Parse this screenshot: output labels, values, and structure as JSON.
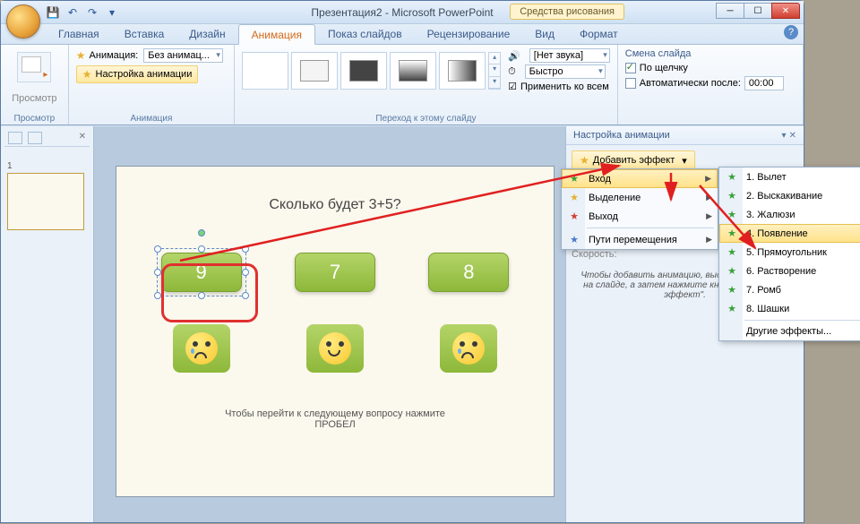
{
  "title": {
    "doc": "Презентация2",
    "app": "Microsoft PowerPoint"
  },
  "contextual_tab": "Средства рисования",
  "win_buttons": {
    "min": "─",
    "max": "☐",
    "close": "✕"
  },
  "tabs": [
    "Главная",
    "Вставка",
    "Дизайн",
    "Анимация",
    "Показ слайдов",
    "Рецензирование",
    "Вид",
    "Формат"
  ],
  "active_tab_index": 3,
  "ribbon": {
    "preview": {
      "label": "Просмотр",
      "btn": "Просмотр"
    },
    "animation": {
      "label": "Анимация",
      "animate_label": "Анимация:",
      "animate_value": "Без анимац...",
      "custom_btn": "Настройка анимации"
    },
    "transition": {
      "label": "Переход к этому слайду",
      "sound_icon": "🔊",
      "sound_value": "[Нет звука]",
      "speed_icon": "⏱",
      "speed_value": "Быстро",
      "apply_all_icon": "☑",
      "apply_all": "Применить ко всем"
    },
    "advance": {
      "title": "Смена слайда",
      "on_click": "По щелчку",
      "auto_after": "Автоматически после:",
      "auto_value": "00:00"
    }
  },
  "taskpane": {
    "title": "Настройка анимации",
    "add_effect": "Добавить эффект",
    "menu": [
      {
        "icon_class": "green",
        "label": "Вход",
        "has_sub": true
      },
      {
        "icon_class": "yellow",
        "label": "Выделение",
        "has_sub": true
      },
      {
        "icon_class": "red",
        "label": "Выход",
        "has_sub": true
      },
      {
        "icon_class": "blue",
        "label": "Пути перемещения",
        "has_sub": true
      }
    ],
    "flyout": [
      {
        "num": "1.",
        "label": "Вылет"
      },
      {
        "num": "2.",
        "label": "Выскакивание"
      },
      {
        "num": "3.",
        "label": "Жалюзи"
      },
      {
        "num": "4.",
        "label": "Появление"
      },
      {
        "num": "5.",
        "label": "Прямоугольник"
      },
      {
        "num": "6.",
        "label": "Растворение"
      },
      {
        "num": "7.",
        "label": "Ромб"
      },
      {
        "num": "8.",
        "label": "Шашки"
      }
    ],
    "flyout_more": "Другие эффекты...",
    "speed_label": "Скорость:",
    "hint": "Чтобы добавить анимацию, выделите элемент на слайде, а затем нажмите кнопку \"Добавить эффект\"."
  },
  "slide": {
    "question": "Сколько будет 3+5?",
    "answers": [
      "9",
      "7",
      "8"
    ],
    "hint_line1": "Чтобы перейти к следующему вопросу нажмите",
    "hint_line2": "ПРОБЕЛ"
  },
  "icons": {
    "star": "★",
    "save": "💾",
    "undo": "↶",
    "redo": "↷",
    "dropdown": "▾"
  },
  "title_sep": " - "
}
